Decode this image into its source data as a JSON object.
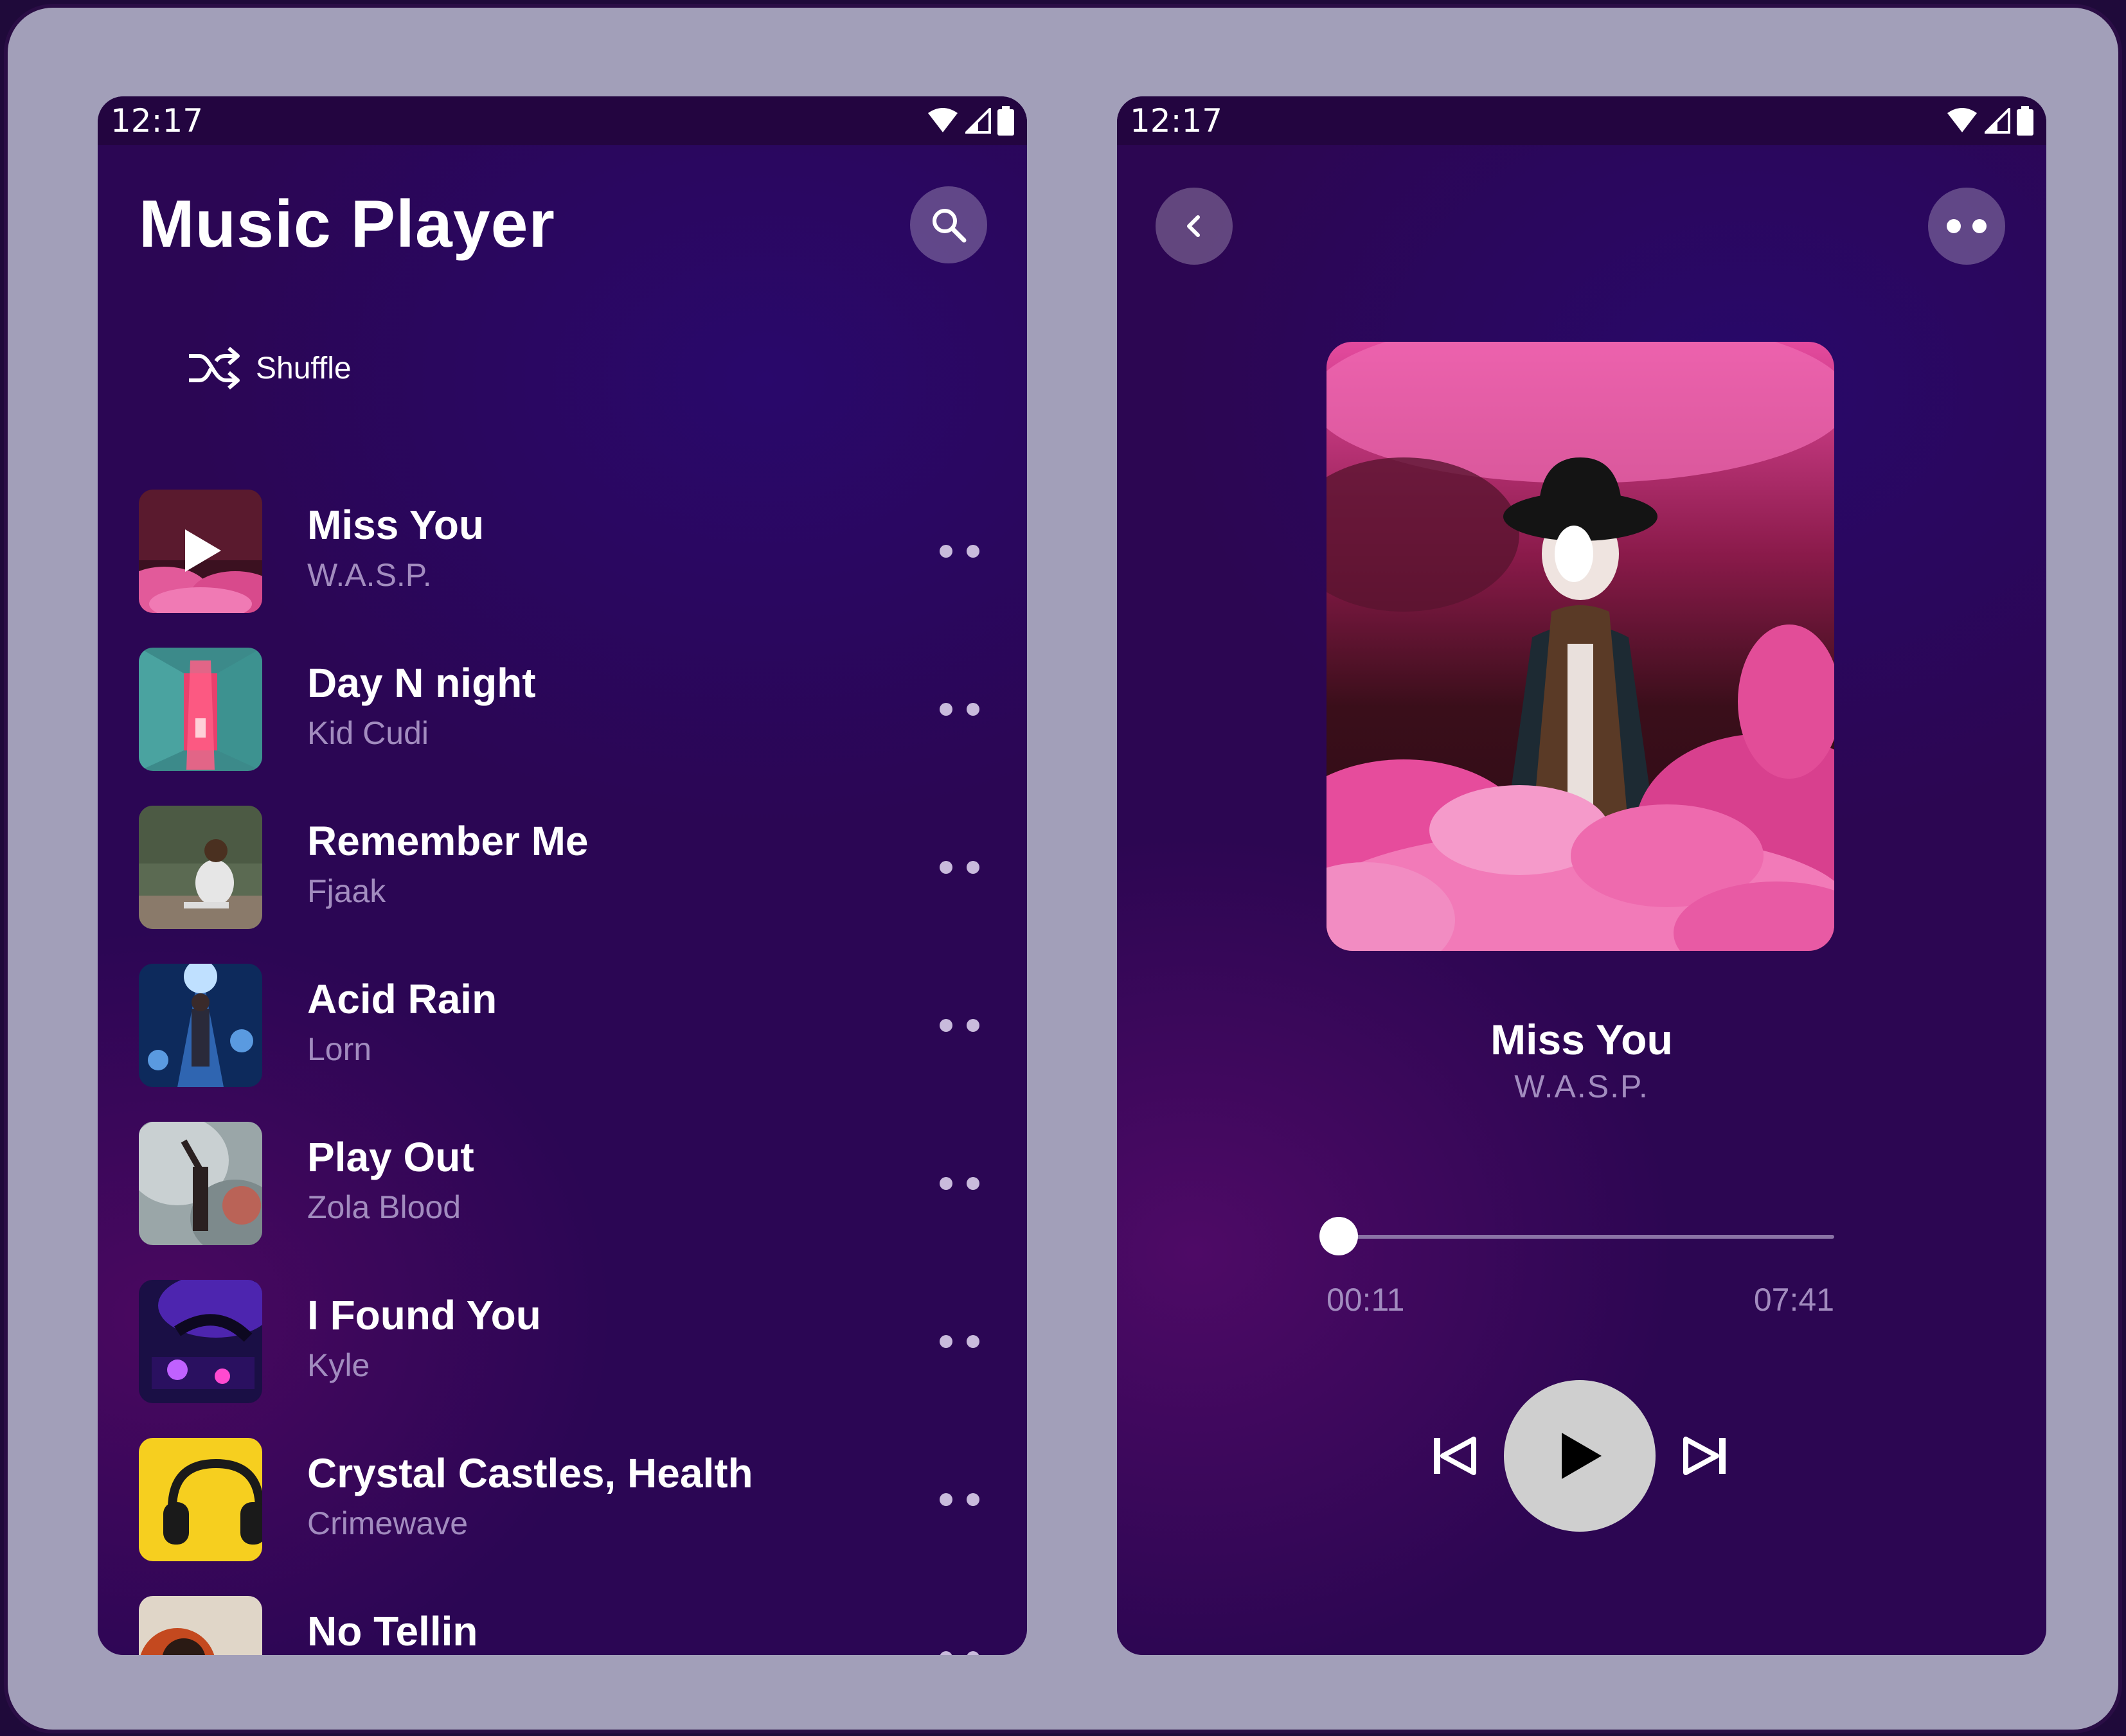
{
  "colors": {
    "phone_background": "#2b0654",
    "accent_pink": "#e21f7d",
    "secondary_text": "#a28cbf",
    "play_button": "#cfcfcf"
  },
  "list_screen": {
    "status_time": "12:17",
    "title": "Music Player",
    "search_icon": "search-icon",
    "shuffle_label": "Shuffle",
    "songs": [
      {
        "title": "Miss You",
        "artist": "W.A.S.P.",
        "playing": true
      },
      {
        "title": "Day N night",
        "artist": "Kid Cudi"
      },
      {
        "title": "Remember Me",
        "artist": "Fjaak"
      },
      {
        "title": "Acid Rain",
        "artist": "Lorn"
      },
      {
        "title": "Play Out",
        "artist": "Zola Blood"
      },
      {
        "title": "I Found You",
        "artist": "Kyle"
      },
      {
        "title": "Crystal Castles, Health",
        "artist": "Crimewave"
      },
      {
        "title": "No Tellin",
        "artist": ""
      }
    ]
  },
  "player_screen": {
    "status_time": "12:17",
    "back_icon": "chevron-left-icon",
    "more_icon": "more-icon",
    "now_playing": {
      "title": "Miss You",
      "artist": "W.A.S.P."
    },
    "progress": {
      "elapsed": "00:11",
      "total": "07:41",
      "fraction": 0.024
    },
    "controls": [
      "skip-previous-icon",
      "play-icon",
      "skip-next-icon"
    ]
  }
}
